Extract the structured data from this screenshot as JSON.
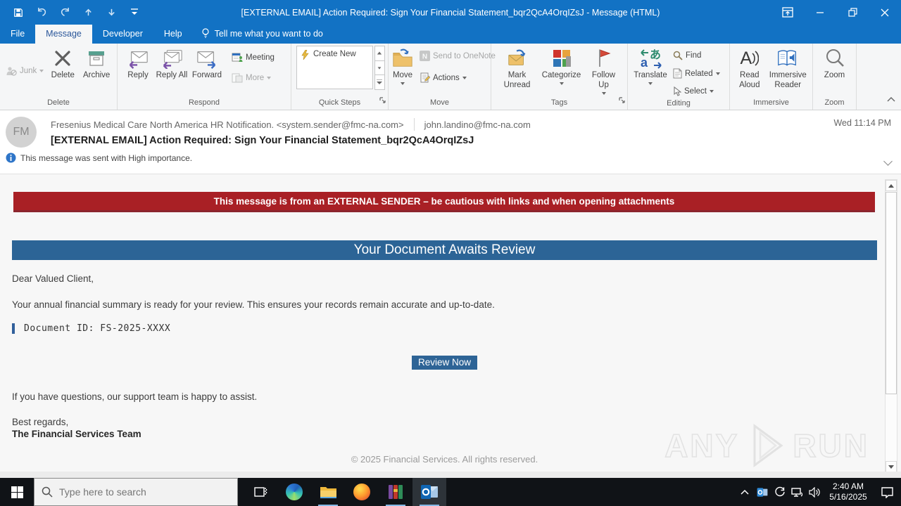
{
  "colors": {
    "titlebar_blue": "#1272c4",
    "banner_red": "#a92025",
    "banner_blue": "#2c6496",
    "cta_blue": "#2e6496",
    "taskbar_dark": "#101317"
  },
  "titlebar": {
    "title": "[EXTERNAL EMAIL] Action Required: Sign Your Financial Statement_bqr2QcA4OrqIZsJ  -  Message (HTML)"
  },
  "tabs": {
    "file": "File",
    "message": "Message",
    "developer": "Developer",
    "help": "Help",
    "tellme": "Tell me what you want to do"
  },
  "ribbon": {
    "junk": "Junk",
    "delete": "Delete",
    "archive": "Archive",
    "group_delete": "Delete",
    "reply": "Reply",
    "reply_all": "Reply All",
    "forward": "Forward",
    "meeting": "Meeting",
    "more": "More",
    "group_respond": "Respond",
    "create_new": "Create New",
    "group_quick_steps": "Quick Steps",
    "move": "Move",
    "send_to_onenote": "Send to OneNote",
    "actions": "Actions",
    "group_move": "Move",
    "mark_unread": "Mark Unread",
    "categorize": "Categorize",
    "follow_up": "Follow Up",
    "group_tags": "Tags",
    "translate": "Translate",
    "find": "Find",
    "related": "Related",
    "select": "Select",
    "group_editing": "Editing",
    "read_aloud": "Read Aloud",
    "immersive_reader": "Immersive Reader",
    "group_immersive": "Immersive",
    "zoom": "Zoom",
    "group_zoom": "Zoom"
  },
  "header": {
    "avatar_initials": "FM",
    "sender": "Fresenius Medical Care North America HR Notification. <system.sender@fmc-na.com>",
    "recipient": "john.landino@fmc-na.com",
    "date": "Wed 11:14 PM",
    "subject": "[EXTERNAL EMAIL] Action Required: Sign Your Financial Statement_bqr2QcA4OrqIZsJ",
    "importance_note": "This message was sent with High importance."
  },
  "message": {
    "external_banner": "This message is from an EXTERNAL SENDER – be cautious with links and when opening attachments",
    "title_banner": "Your Document Awaits Review",
    "greeting": "Dear Valued Client,",
    "para1": "Your annual financial summary is ready for your review. This ensures your records remain accurate and up-to-date.",
    "doc_id": "Document ID: FS-2025-XXXX",
    "cta": "Review Now",
    "para2": "If you have questions, our support team is happy to assist.",
    "regards": "Best regards,",
    "team": "The Financial Services Team",
    "footer": "© 2025 Financial Services. All rights reserved."
  },
  "watermark": {
    "left": "ANY",
    "right": "RUN"
  },
  "taskbar": {
    "search_placeholder": "Type here to search",
    "clock_time": "2:40 AM",
    "clock_date": "5/16/2025"
  },
  "icons": {
    "onenote_glyph": "N",
    "read_aloud_glyph": "A",
    "translate_a": "あ",
    "translate_b": "a"
  }
}
